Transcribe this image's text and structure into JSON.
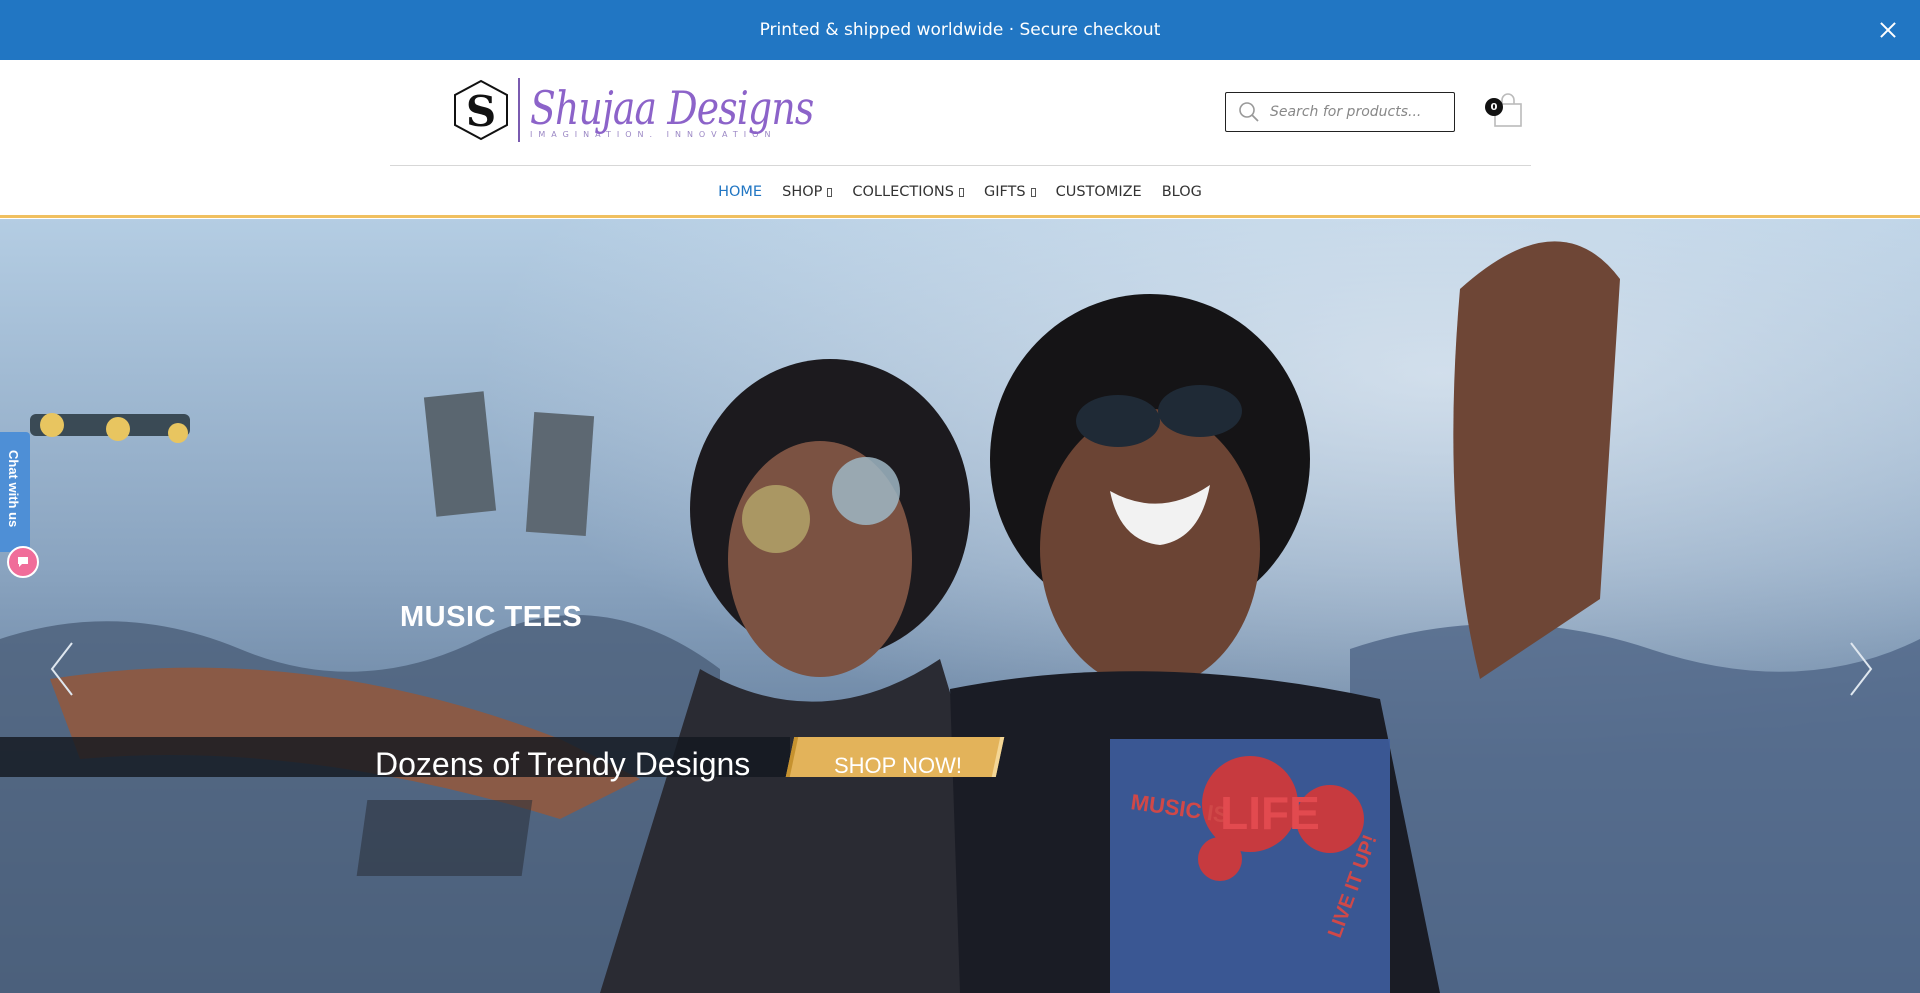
{
  "announcement": {
    "text": "Printed & shipped worldwide · Secure checkout",
    "close_icon": "close-icon"
  },
  "brand": {
    "name": "Shujaa Designs",
    "tagline": "IMAGINATION. INNOVATION",
    "logo_icon": "hexagon-s-logo"
  },
  "search": {
    "placeholder": "Search for products...",
    "icon": "search-icon"
  },
  "cart": {
    "count": "0",
    "icon": "shopping-bag-icon"
  },
  "nav": {
    "items": [
      {
        "label": "HOME",
        "active": true
      },
      {
        "label": "SHOP",
        "dropdown": true
      },
      {
        "label": "COLLECTIONS",
        "dropdown": true
      },
      {
        "label": "GIFTS",
        "dropdown": true
      },
      {
        "label": "CUSTOMIZE"
      },
      {
        "label": "BLOG"
      }
    ]
  },
  "hero": {
    "caption": "MUSIC TEES",
    "subtitle": "Dozens of Trendy Designs",
    "cta": "SHOP NOW!",
    "prev_icon": "chevron-left-icon",
    "next_icon": "chevron-right-icon",
    "tshirt_print": [
      "MUSIC IS",
      "LIFE",
      "LIVE IT UP!"
    ]
  },
  "chat": {
    "label": "Chat with us",
    "icon": "chat-bubble-icon"
  },
  "colors": {
    "announcement_bg": "#2176c3",
    "accent_gold": "#e3b35a",
    "brand_purple": "#8c63c9",
    "chat_blue": "#4e8fd6",
    "chat_pink": "#f06d9a"
  }
}
